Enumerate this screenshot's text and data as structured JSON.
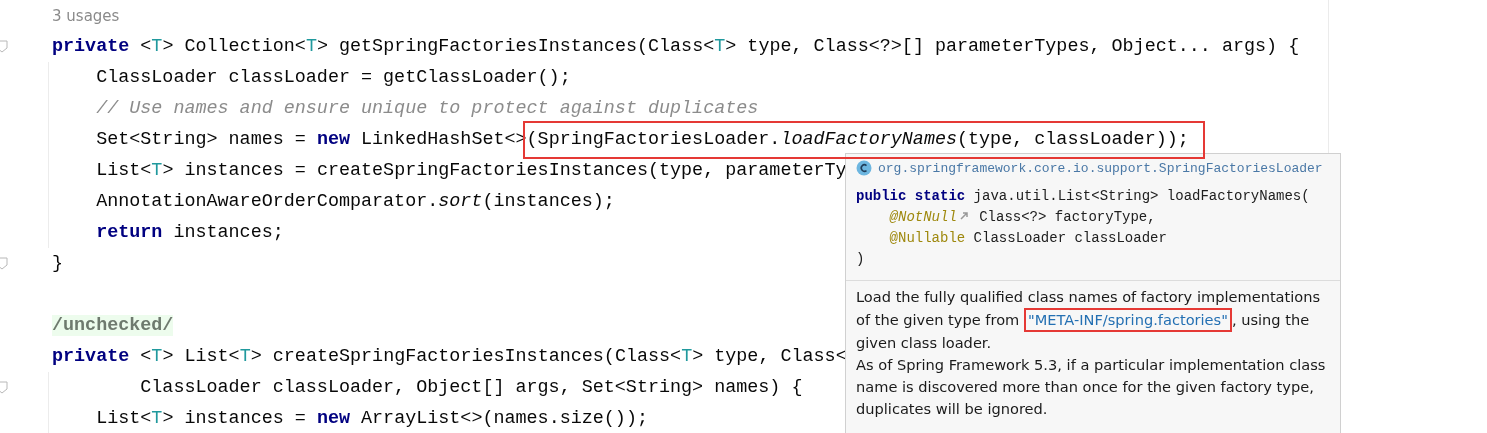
{
  "editor": {
    "usages": "3 usages",
    "lines": [
      {
        "fold": true,
        "guide": false,
        "tokens": [
          {
            "kind": "keyword",
            "text": "private"
          },
          {
            "kind": "plain",
            "text": " <"
          },
          {
            "kind": "type-param",
            "text": "T"
          },
          {
            "kind": "plain",
            "text": "> Collection<"
          },
          {
            "kind": "type-param",
            "text": "T"
          },
          {
            "kind": "plain",
            "text": "> getSpringFactoriesInstances(Class<"
          },
          {
            "kind": "type-param",
            "text": "T"
          },
          {
            "kind": "plain",
            "text": "> type, Class<?>[] parameterTypes, Object... args) {"
          }
        ]
      },
      {
        "fold": false,
        "guide": true,
        "indented": true,
        "tokens": [
          {
            "kind": "plain",
            "text": "ClassLoader classLoader = getClassLoader();"
          }
        ]
      },
      {
        "fold": false,
        "guide": true,
        "indented": true,
        "tokens": [
          {
            "kind": "comment",
            "text": "// Use names and ensure unique to protect against duplicates"
          }
        ]
      },
      {
        "fold": false,
        "guide": true,
        "indented": true,
        "tokens": [
          {
            "kind": "plain",
            "text": "Set<String> names = "
          },
          {
            "kind": "keyword",
            "text": "new"
          },
          {
            "kind": "plain",
            "text": " LinkedHashSet<>"
          },
          {
            "kind": "box",
            "children": [
              {
                "kind": "plain",
                "text": "(SpringFactoriesLoader."
              },
              {
                "kind": "static-call",
                "text": "loadFactoryNames"
              },
              {
                "kind": "plain",
                "text": "(type, classLoader));"
              }
            ]
          }
        ]
      },
      {
        "fold": false,
        "guide": true,
        "indented": true,
        "tokens": [
          {
            "kind": "plain",
            "text": "List<"
          },
          {
            "kind": "type-param",
            "text": "T"
          },
          {
            "kind": "plain",
            "text": "> instances = createSpringFactoriesInstances(type, parameterTy"
          }
        ]
      },
      {
        "fold": false,
        "guide": true,
        "indented": true,
        "tokens": [
          {
            "kind": "plain",
            "text": "AnnotationAwareOrderComparator."
          },
          {
            "kind": "static-call",
            "text": "sort"
          },
          {
            "kind": "plain",
            "text": "(instances);"
          }
        ]
      },
      {
        "fold": false,
        "guide": true,
        "indented": true,
        "tokens": [
          {
            "kind": "keyword",
            "text": "return"
          },
          {
            "kind": "plain",
            "text": " instances;"
          }
        ]
      },
      {
        "fold": true,
        "guide": false,
        "tokens": [
          {
            "kind": "plain",
            "text": "}"
          }
        ]
      },
      {
        "fold": false,
        "guide": false
      },
      {
        "fold": false,
        "guide": false,
        "tokens": [
          {
            "kind": "annotation",
            "text": "/unchecked/"
          }
        ]
      },
      {
        "fold": false,
        "guide": false,
        "tokens": [
          {
            "kind": "keyword",
            "text": "private"
          },
          {
            "kind": "plain",
            "text": " <"
          },
          {
            "kind": "type-param",
            "text": "T"
          },
          {
            "kind": "plain",
            "text": "> List<"
          },
          {
            "kind": "type-param",
            "text": "T"
          },
          {
            "kind": "plain",
            "text": "> createSpringFactoriesInstances(Class<"
          },
          {
            "kind": "type-param",
            "text": "T"
          },
          {
            "kind": "plain",
            "text": "> type, Class<"
          }
        ]
      },
      {
        "fold": true,
        "guide": true,
        "continuation": true,
        "tokens": [
          {
            "kind": "plain",
            "text": "ClassLoader classLoader, Object[] args, Set<String> names) {"
          }
        ]
      },
      {
        "fold": false,
        "guide": true,
        "indented": true,
        "tokens": [
          {
            "kind": "plain",
            "text": "List<"
          },
          {
            "kind": "type-param",
            "text": "T"
          },
          {
            "kind": "plain",
            "text": "> instances = "
          },
          {
            "kind": "keyword",
            "text": "new"
          },
          {
            "kind": "plain",
            "text": " ArrayList<>(names.size());"
          }
        ]
      }
    ]
  },
  "tooltip": {
    "class_name": "org.springframework.core.io.support.SpringFactoriesLoader",
    "signature": [
      {
        "tokens": [
          {
            "kind": "keyword",
            "text": "public static"
          },
          {
            "kind": "plain",
            "text": " java.util.List<String> loadFactoryNames("
          }
        ]
      },
      {
        "indented": true,
        "tokens": [
          {
            "kind": "param-annotation",
            "text": "@NotNull"
          },
          {
            "kind": "external-link"
          },
          {
            "kind": "plain",
            "text": " Class<?> factoryType,"
          }
        ]
      },
      {
        "indented": true,
        "tokens": [
          {
            "kind": "param-annotation-plain",
            "text": "@Nullable"
          },
          {
            "kind": "plain",
            "text": " ClassLoader classLoader"
          }
        ]
      },
      {
        "tokens": [
          {
            "kind": "plain",
            "text": ")"
          }
        ]
      }
    ],
    "doc": [
      {
        "parts": [
          {
            "kind": "text",
            "text": "Load the fully qualified class names of factory implementations of the given type from "
          },
          {
            "kind": "link",
            "boxed": true,
            "text": "\"META-INF/spring.factories\""
          },
          {
            "kind": "text",
            "text": ", using the given class loader."
          }
        ]
      },
      {
        "parts": [
          {
            "kind": "text",
            "text": "As of Spring Framework 5.3, if a particular implementation class name is discovered more than once for the given factory type, duplicates will be ignored."
          }
        ]
      }
    ]
  }
}
